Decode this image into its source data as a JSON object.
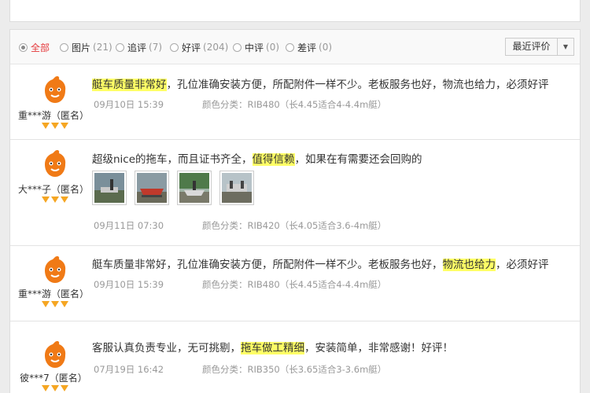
{
  "filters": [
    {
      "label": "全部",
      "count": "",
      "active": true
    },
    {
      "label": "图片",
      "count": "(21)",
      "active": false
    },
    {
      "label": "追评",
      "count": "(7)",
      "active": false
    },
    {
      "label": "好评",
      "count": "(204)",
      "active": false
    },
    {
      "label": "中评",
      "count": "(0)",
      "active": false
    },
    {
      "label": "差评",
      "count": "(0)",
      "active": false
    }
  ],
  "sort": {
    "label": "最近评价"
  },
  "reviews": [
    {
      "user": "重***游（匿名）",
      "pre": "",
      "highlight": "艇车质量非常好",
      "post": "，孔位准确安装方便，所配附件一样不少。老板服务也好，物流也给力，必须好评",
      "date": "09月10日 15:39",
      "spec": "颜色分类：RIB480（长4.45适合4-4.4m艇）"
    },
    {
      "user": "大***子（匿名）",
      "pre": "超级nice的拖车，而且证书齐全，",
      "highlight": "值得信赖",
      "post": "，如果在有需要还会回购的",
      "date": "09月11日 07:30",
      "spec": "颜色分类：RIB420（长4.05适合3.6-4m艇）"
    },
    {
      "user": "重***游（匿名）",
      "pre": "艇车质量非常好，孔位准确安装方便，所配附件一样不少。老板服务也好，",
      "highlight": "物流也给力",
      "post": "，必须好评",
      "date": "09月10日 15:39",
      "spec": "颜色分类：RIB480（长4.45适合4-4.4m艇）"
    },
    {
      "user": "彼***7（匿名）",
      "pre": "客服认真负责专业，无可挑剔，",
      "highlight": "拖车做工精细",
      "post": "，安装简单，非常感谢！好评！",
      "date": "07月19日 16:42",
      "spec": "颜色分类：RIB350（长3.65适合3-3.6m艇）"
    }
  ],
  "colors": {
    "accent": "#e4393c",
    "highlight": "#ffff66",
    "rank": "#f5a623",
    "avatar": "#f07a16"
  }
}
